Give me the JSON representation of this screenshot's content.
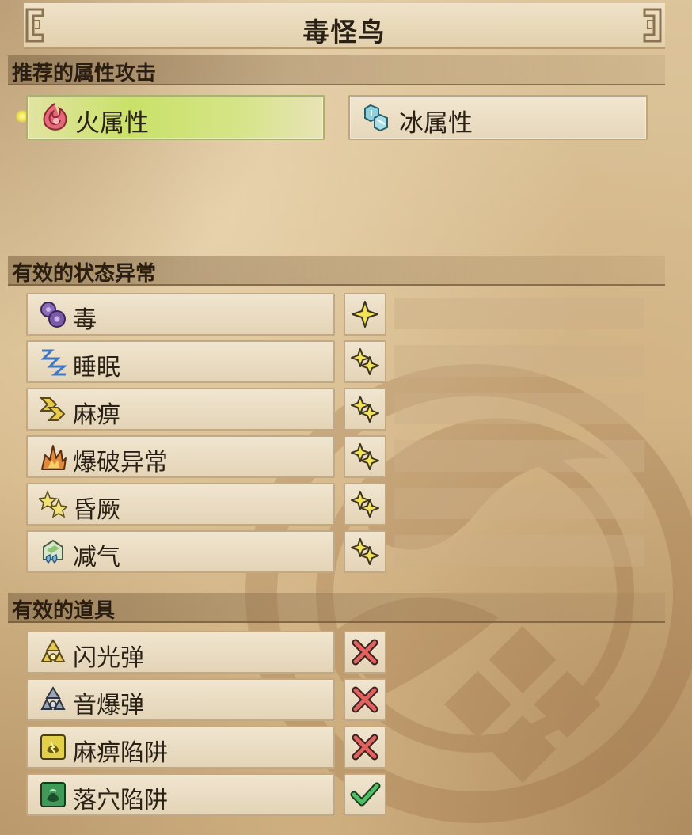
{
  "title": "毒怪鸟",
  "sections": {
    "recommended": "推荐的属性攻击",
    "status": "有效的状态异常",
    "items": "有效的道具"
  },
  "elements": [
    {
      "label": "火属性",
      "icon": "fire-element-icon",
      "selected": true
    },
    {
      "label": "冰属性",
      "icon": "ice-element-icon",
      "selected": false
    }
  ],
  "status_effects": [
    {
      "label": "毒",
      "icon": "poison-icon",
      "rating_stars": 1
    },
    {
      "label": "睡眠",
      "icon": "sleep-icon",
      "rating_stars": 2
    },
    {
      "label": "麻痹",
      "icon": "paralysis-icon",
      "rating_stars": 2
    },
    {
      "label": "爆破异常",
      "icon": "blast-icon",
      "rating_stars": 2
    },
    {
      "label": "昏厥",
      "icon": "stun-icon",
      "rating_stars": 2
    },
    {
      "label": "减气",
      "icon": "exhaust-icon",
      "rating_stars": 2
    }
  ],
  "items": [
    {
      "label": "闪光弹",
      "icon": "flash-pod-icon",
      "effective": false
    },
    {
      "label": "音爆弹",
      "icon": "screamer-pod-icon",
      "effective": false
    },
    {
      "label": "麻痹陷阱",
      "icon": "shock-trap-icon",
      "effective": false
    },
    {
      "label": "落穴陷阱",
      "icon": "pitfall-trap-icon",
      "effective": true
    }
  ],
  "colors": {
    "selected_highlight": "#c9e168",
    "star": "#f2e35a",
    "cross": "#e0615e",
    "check": "#4fbf63"
  }
}
